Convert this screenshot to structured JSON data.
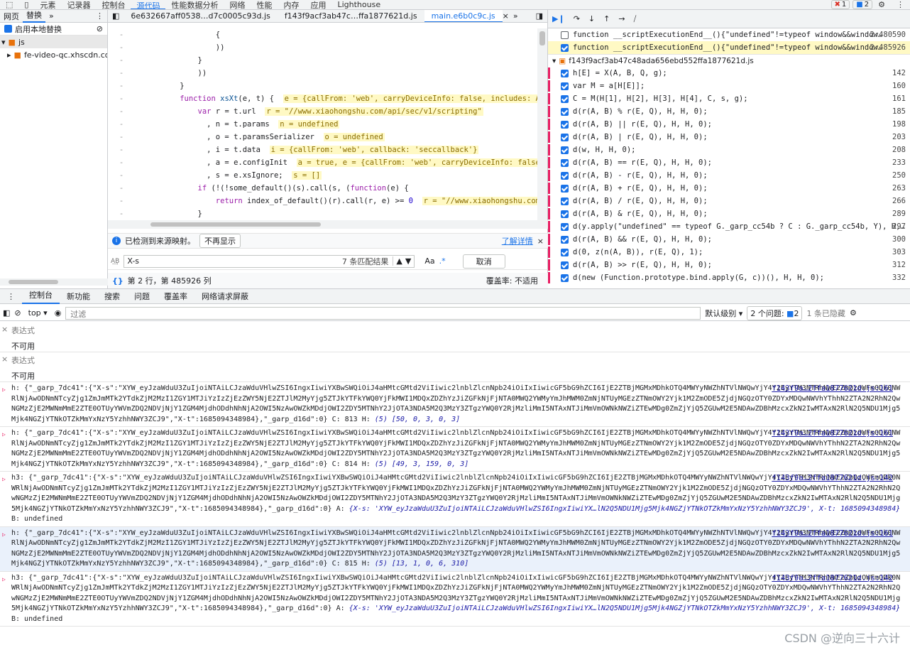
{
  "topbar": {
    "tabs": [
      "元素",
      "记录器",
      "控制台",
      "源代码",
      "性能数据分析",
      "网络",
      "性能",
      "内存",
      "应用",
      "Lighthouse"
    ],
    "active": "源代码",
    "error_count": "1",
    "issue_count": "2"
  },
  "navigator": {
    "tabs": [
      "网页",
      "替换"
    ],
    "active": "替换",
    "enable_override_label": "启用本地替换",
    "folder": "js",
    "subfolder": "fe-video-qc.xhscdn.com"
  },
  "editor": {
    "file_tabs": [
      "6e632667aff0538…d7c0005c93d.js",
      "f143f9acf3ab47c…ffa1877621d.js",
      "main.e6b0c9c.js"
    ],
    "active_tab": "main.e6b0c9c.js",
    "source_map_message": "已检测到来源映射。",
    "dont_show_label": "不再显示",
    "learn_more_label": "了解详情",
    "search_value": "X-s",
    "match_count": "7 条匹配结果",
    "case_label": "Aa",
    "regex_label": ".*",
    "cancel_label": "取消",
    "status_position": "第 2 行，第 485926 列",
    "coverage_label": "覆盖率: 不适用"
  },
  "debugger": {
    "script_end_rows": [
      {
        "checked": false,
        "text": "function __scriptExecutionEnd__(){\"undefined\"!=typeof window&&window…",
        "line": "2:480590"
      },
      {
        "checked": true,
        "text": "function __scriptExecutionEnd__(){\"undefined\"!=typeof window&&window…",
        "line": "2:485926"
      }
    ],
    "file_label": "f143f9acf3ab47c48ada656ebd552ffa1877621d.js",
    "breakpoints": [
      {
        "text": "h[E] = X(A, B, Q, g);",
        "line": "142"
      },
      {
        "text": "var M = a[H[E]];",
        "line": "160"
      },
      {
        "text": "C = M(H[1], H[2], H[3], H[4], C, s, g);",
        "line": "161"
      },
      {
        "text": "d(r(A, B) % r(E, Q), H, H, 0);",
        "line": "185"
      },
      {
        "text": "d(r(A, B) || r(E, Q), H, H, 0);",
        "line": "198"
      },
      {
        "text": "d(r(A, B) | r(E, Q), H, H, 0);",
        "line": "203"
      },
      {
        "text": "d(w, H, H, 0);",
        "line": "208"
      },
      {
        "text": "d(r(A, B) == r(E, Q), H, H, 0);",
        "line": "233"
      },
      {
        "text": "d(r(A, B) - r(E, Q), H, H, 0);",
        "line": "250"
      },
      {
        "text": "d(r(A, B) + r(E, Q), H, H, 0);",
        "line": "263"
      },
      {
        "text": "d(r(A, B) / r(E, Q), H, H, 0);",
        "line": "266"
      },
      {
        "text": "d(r(A, B) & r(E, Q), H, H, 0);",
        "line": "289"
      },
      {
        "text": "d(y.apply(\"undefined\" == typeof G._garp_cc54b ? C : G._garp_cc54b, Y), H,…",
        "line": "297"
      },
      {
        "text": "d(r(A, B) && r(E, Q), H, H, 0);",
        "line": "300"
      },
      {
        "text": "d(0, z(n(A, B)), r(E, Q), 1);",
        "line": "303"
      },
      {
        "text": "d(r(A, B) >> r(E, Q), H, H, 0);",
        "line": "312"
      },
      {
        "text": "d(new (Function.prototype.bind.apply(G, c))(), H, H, 0);",
        "line": "332"
      }
    ]
  },
  "drawer": {
    "tabs": [
      "控制台",
      "新功能",
      "搜索",
      "问题",
      "覆盖率",
      "网络请求屏蔽"
    ],
    "active": "控制台",
    "context": "top",
    "filter_placeholder": "过滤",
    "level_label": "默认级别",
    "issues_label": "2 个问题:",
    "issues_count": "2",
    "hidden_label": "1 条已隐藏"
  },
  "console": {
    "expressions": [
      {
        "label": "表达式",
        "value": "不可用"
      },
      {
        "label": "表达式",
        "value": "不可用"
      }
    ],
    "logs": [
      {
        "prefix": "h:",
        "body": "{\"_garp_7dc41\":{\"X-s\":\"XYW_eyJzaWduU3ZuIjoiNTAiLCJzaWduVHlwZSI6IngxIiwiYXBwSWQiOiJ4aHMtcGMtd2ViIiwic2lnblZlcnNpb24iOiIxIiwicGF5bG9hZCI6IjE2ZTBjMGMxMDhkOTQ4MWYyNWZhNTVlNWQwYjY4Y2EyYTM3NTRhNWE2ZmQzOWFmODk0NWRlNjAwODNmNTcyZjg1ZmJmMTk2YTdkZjM2MzI1ZGY1MTJiYzIzZjEzZWY5NjE2ZTJlM2MyYjg5ZTJkYTFkYWQ0YjFkMWI1MDQxZDZhYzJiZGFkNjFjNTA0MWQ2YWMyYmJhMWM0ZmNjNTUyMGEzZTNmOWY2Yjk1M2ZmODE5ZjdjNGQzOTY0ZDYxMDQwNWVhYThhN2ZTA2N2RhN2QwNGMzZjE2MWNmMmE2ZTE0OTUyYWVmZDQ2NDVjNjY1ZGM4MjdhODdhNhNjA2OWI5NzAwOWZkMDdjOWI2ZDY5MTNhY2JjOTA3NDA5M2Q3MzY3ZTgzYWQ0Y2RjMzliMmI5NTAxNTJiMmVmOWNkNWZiZTEwMDg0ZmZjYjQ5ZGUwM2E5NDAwZDBhMzcxZkN2IwMTAxN2RlN2Q5NDU1Mjg5Mjk4NGZjYTNkOTZkMmYxNzY5YzhhNWY3ZCJ9\",\"X-t\":1685094348984},\"_garp_d16d\":0}",
        "suffix": "C: 813 H:",
        "tail": "(5) [50, 0, 3, 0, 3]",
        "source": "f143f9a…2ffa1877621d.js:161"
      },
      {
        "prefix": "h:",
        "body": "{\"_garp_7dc41\":{\"X-s\":\"XYW_eyJzaWduU3ZuIjoiNTAiLCJzaWduVHlwZSI6IngxIiwiYXBwSWQiOiJ4aHMtcGMtd2ViIiwic2lnblZlcnNpb24iOiIxIiwicGF5bG9hZCI6IjE2ZTBjMGMxMDhkOTQ4MWYyNWZhNTVlNWQwYjY4Y2EyYTM3NTRhNWE2ZmQzOWFmODk0NWRlNjAwODNmNTcyZjg1ZmJmMTk2YTdkZjM2MzI1ZGY1MTJiYzIzZjEzZWY5NjE2ZTJlM2MyYjg5ZTJkYTFkYWQ0YjFkMWI1MDQxZDZhYzJiZGFkNjFjNTA0MWQ2YWMyYmJhMWM0ZmNjNTUyMGEzZTNmOWY2Yjk1M2ZmODE5ZjdjNGQzOTY0ZDYxMDQwNWVhYThhN2ZTA2N2RhN2QwNGMzZjE2MWNmMmE2ZTE0OTUyYWVmZDQ2NDVjNjY1ZGM4MjdhODdhNhNjA2OWI5NzAwOWZkMDdjOWI2ZDY5MTNhY2JjOTA3NDA5M2Q3MzY3ZTgzYWQ0Y2RjMzliMmI5NTAxNTJiMmVmOWNkNWZiZTEwMDg0ZmZjYjQ5ZGUwM2E5NDAwZDBhMzcxZkN2IwMTAxN2RlN2Q5NDU1Mjg5Mjk4NGZjYTNkOTZkMmYxNzY5YzhhNWY3ZCJ9\",\"X-t\":1685094348984},\"_garp_d16d\":0}",
        "suffix": "C: 814 H:",
        "tail": "(5) [49, 3, 159, 0, 3]",
        "source": "f143f9a…2ffa1877621d.js:161"
      },
      {
        "prefix": "h3:",
        "body": "{\"_garp_7dc41\":{\"X-s\":\"XYW_eyJzaWduU3ZuIjoiNTAiLCJzaWduVHlwZSI6IngxIiwiYXBwSWQiOiJ4aHMtcGMtd2ViIiwic2lnblZlcnNpb24iOiIxIiwicGF5bG9hZCI6IjE2ZTBjMGMxMDhkOTQ4MWYyNWZhNTVlNWQwYjY4Y2EyYTM3NTRhNWE2ZmQzOWFmODk0NWRlNjAwODNmNTcyZjg1ZmJmMTk2YTdkZjM2MzI1ZGY1MTJiYzIzZjEzZWY5NjE2ZTJlM2MyYjg5ZTJkYTFkYWQ0YjFkMWI1MDQxZDZhYzJiZGFkNjFjNTA0MWQ2YWMyYmJhMWM0ZmNjNTUyMGEzZTNmOWY2Yjk1M2ZmODE5ZjdjNGQzOTY0ZDYxMDQwNWVhYThhN2ZTA2N2RhN2QwNGMzZjE2MWNmMmE2ZTE0OTUyYWVmZDQ2NDVjNjY1ZGM4MjdhODdhNhNjA2OWI5NzAwOWZkMDdjOWI2ZDY5MTNhY2JjOTA3NDA5M2Q3MzY3ZTgzYWQ0Y2RjMzliMmI5NTAxNTJiMmVmOWNkNWZiZTEwMDg0ZmZjYjQ5ZGUwM2E5NDAwZDBhMzcxZkN2IwMTAxN2RlN2Q5NDU1Mjg5Mjk4NGZjYTNkOTZkMmYxNzY5YzhhNWY3ZCJ9\",\"X-t\":1685094348984},\"_garp_d16d\":0}",
        "suffix": "A:",
        "tail": "{X-s: 'XYW_eyJzaWduU3ZuIjoiNTAiLCJzaWduVHlwZSI6IngxIiwiYX…lN2Q5NDU1Mjg5Mjk4NGZjYTNkOTZkMmYxNzY5YzhhNWY3ZCJ9', X-t: 1685094348984}",
        "after": "B: undefined",
        "source": "f143f9a…2ffa1877621d.js:142"
      },
      {
        "prefix": "h:",
        "body": "{\"_garp_7dc41\":{\"X-s\":\"XYW_eyJzaWduU3ZuIjoiNTAiLCJzaWduVHlwZSI6IngxIiwiYXBwSWQiOiJ4aHMtcGMtd2ViIiwic2lnblZlcnNpb24iOiIxIiwicGF5bG9hZCI6IjE2ZTBjMGMxMDhkOTQ4MWYyNWZhNTVlNWQwYjY4Y2EyYTM3NTRhNWE2ZmQzOWFmODk0NWRlNjAwODNmNTcyZjg1ZmJmMTk2YTdkZjM2MzI1ZGY1MTJiYzIzZjEzZWY5NjE2ZTJlM2MyYjg5ZTJkYTFkYWQ0YjFkMWI1MDQxZDZhYzJiZGFkNjFjNTA0MWQ2YWMyYmJhMWM0ZmNjNTUyMGEzZTNmOWY2Yjk1M2ZmODE5ZjdjNGQzOTY0ZDYxMDQwNWVhYThhN2ZTA2N2RhN2QwNGMzZjE2MWNmMmE2ZTE0OTUyYWVmZDQ2NDVjNjY1ZGM4MjdhODdhNhNjA2OWI5NzAwOWZkMDdjOWI2ZDY5MTNhY2JjOTA3NDA5M2Q3MzY3ZTgzYWQ0Y2RjMzliMmI5NTAxNTJiMmVmOWNkNWZiZTEwMDg0ZmZjYjQ5ZGUwM2E5NDAwZDBhMzcxZkN2IwMTAxN2RlN2Q5NDU1Mjg5Mjk4NGZjYTNkOTZkMmYxNzY5YzhhNWY3ZCJ9\",\"X-t\":1685094348984},\"_garp_d16d\":0}",
        "suffix": "C: 815 H:",
        "tail": "(5) [13, 1, 0, 6, 310]",
        "source": "f143f9a…2ffa1877621d.js:161"
      },
      {
        "prefix": "h3:",
        "body": "{\"_garp_7dc41\":{\"X-s\":\"XYW_eyJzaWduU3ZuIjoiNTAiLCJzaWduVHlwZSI6IngxIiwiYXBwSWQiOiJ4aHMtcGMtd2ViIiwic2lnblZlcnNpb24iOiIxIiwicGF5bG9hZCI6IjE2ZTBjMGMxMDhkOTQ4MWYyNWZhNTVlNWQwYjY4Y2EyYTM3NTRhNWE2ZmQzOWFmODk0NWRlNjAwODNmNTcyZjg1ZmJmMTk2YTdkZjM2MzI1ZGY1MTJiYzIzZjEzZWY5NjE2ZTJlM2MyYjg5ZTJkYTFkYWQ0YjFkMWI1MDQxZDZhYzJiZGFkNjFjNTA0MWQ2YWMyYmJhMWM0ZmNjNTUyMGEzZTNmOWY2Yjk1M2ZmODE5ZjdjNGQzOTY0ZDYxMDQwNWVhYThhN2ZTA2N2RhN2QwNGMzZjE2MWNmMmE2ZTE0OTUyYWVmZDQ2NDVjNjY1ZGM4MjdhODdhNhNjA2OWI5NzAwOWZkMDdjOWI2ZDY5MTNhY2JjOTA3NDA5M2Q3MzY3ZTgzYWQ0Y2RjMzliMmI5NTAxNTJiMmVmOWNkNWZiZTEwMDg0ZmZjYjQ5ZGUwM2E5NDAwZDBhMzcxZkN2IwMTAxN2RlN2Q5NDU1Mjg5Mjk4NGZjYTNkOTZkMmYxNzY5YzhhNWY3ZCJ9\",\"X-t\":1685094348984},\"_garp_d16d\":0}",
        "suffix": "A:",
        "tail": "{X-s: 'XYW_eyJzaWduU3ZuIjoiNTAiLCJzaWduVHlwZSI6IngxIiwiYX…lN2Q5NDU1Mjg5Mjk4NGZjYTNkOTZkMmYxNzY5YzhhNWY3ZCJ9', X-t: 1685094348984}",
        "after": "B: undefined",
        "source": "f143f9a…2ffa1877621d.js:142"
      }
    ]
  },
  "watermark": "CSDN @逆向三十六计",
  "colors": {
    "accent": "#1a73e8",
    "breakpoint": "#e91e63",
    "highlight_line": "#d0e0fb"
  }
}
